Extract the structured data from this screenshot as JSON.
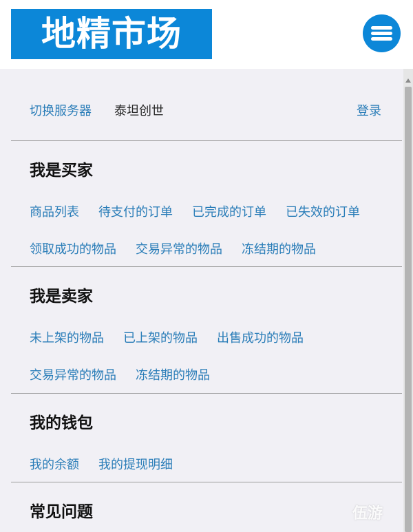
{
  "header": {
    "logo_text": "地精市场",
    "menu_icon": "hamburger-menu-icon"
  },
  "topbar": {
    "switch_server": "切换服务器",
    "server_name": "泰坦创世",
    "login": "登录"
  },
  "sections": [
    {
      "title": "我是买家",
      "rows": [
        [
          "商品列表",
          "待支付的订单",
          "已完成的订单",
          "已失效的订单"
        ],
        [
          "领取成功的物品",
          "交易异常的物品",
          "冻结期的物品"
        ]
      ]
    },
    {
      "title": "我是卖家",
      "rows": [
        [
          "未上架的物品",
          "已上架的物品",
          "出售成功的物品"
        ],
        [
          "交易异常的物品",
          "冻结期的物品"
        ]
      ]
    },
    {
      "title": "我的钱包",
      "rows": [
        [
          "我的余额",
          "我的提现明细"
        ]
      ]
    },
    {
      "title": "常见问题",
      "rows": []
    }
  ],
  "watermark": "伍游",
  "colors": {
    "brand": "#0c87d8",
    "link": "#2a7db8",
    "background": "#f1f0f5"
  }
}
